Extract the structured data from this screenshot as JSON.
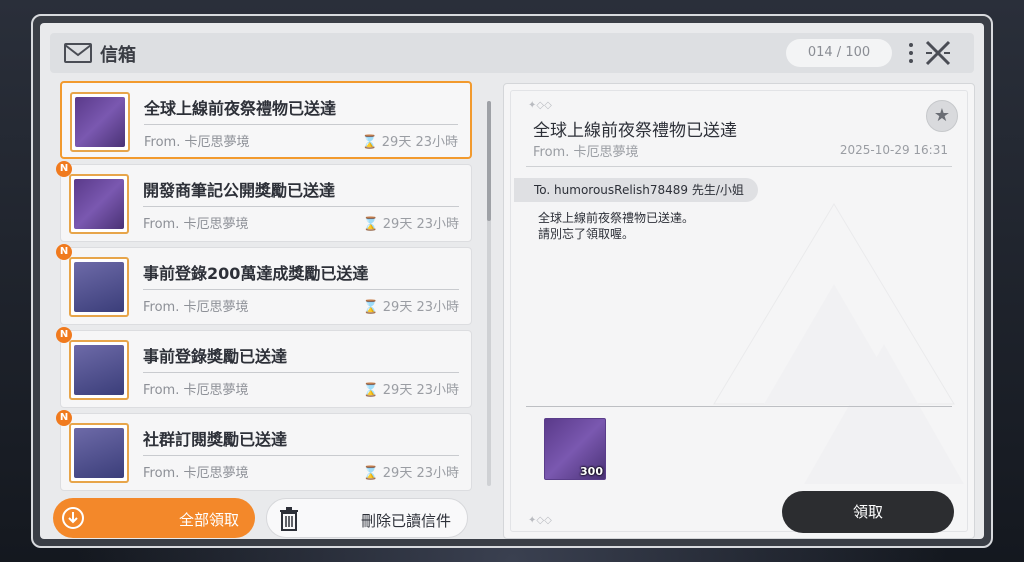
{
  "header": {
    "title": "信箱",
    "counter": "014 / 100"
  },
  "mails": [
    {
      "title": "全球上線前夜祭禮物已送達",
      "from": "From. 卡厄思夢境",
      "expire": "29天 23小時",
      "badge": "",
      "icon": "crystal-icon",
      "selected": true
    },
    {
      "title": "開發商筆記公開獎勵已送達",
      "from": "From. 卡厄思夢境",
      "expire": "29天 23小時",
      "badge": "N",
      "icon": "crystal-icon",
      "selected": false
    },
    {
      "title": "事前登錄200萬達成獎勵已送達",
      "from": "From. 卡厄思夢境",
      "expire": "29天 23小時",
      "badge": "N",
      "icon": "supply-box-icon",
      "selected": false
    },
    {
      "title": "事前登錄獎勵已送達",
      "from": "From. 卡厄思夢境",
      "expire": "29天 23小時",
      "badge": "N",
      "icon": "supply-box-icon",
      "selected": false
    },
    {
      "title": "社群訂閱獎勵已送達",
      "from": "From. 卡厄思夢境",
      "expire": "29天 23小時",
      "badge": "N",
      "icon": "supply-box-icon",
      "selected": false
    }
  ],
  "actions": {
    "claim_all": "全部領取",
    "delete_read": "刪除已讀信件"
  },
  "detail": {
    "title": "全球上線前夜祭禮物已送達",
    "from": "From. 卡厄思夢境",
    "date": "2025-10-29 16:31",
    "to": "To. humorousRelish78489 先生/小姐",
    "body_line1": "全球上線前夜祭禮物已送達。",
    "body_line2": "請別忘了領取喔。",
    "reward_qty": "300",
    "claim": "領取"
  },
  "colors": {
    "accent": "#f3882a",
    "dark_button": "#2c2d30",
    "badge": "#f07a1e"
  }
}
